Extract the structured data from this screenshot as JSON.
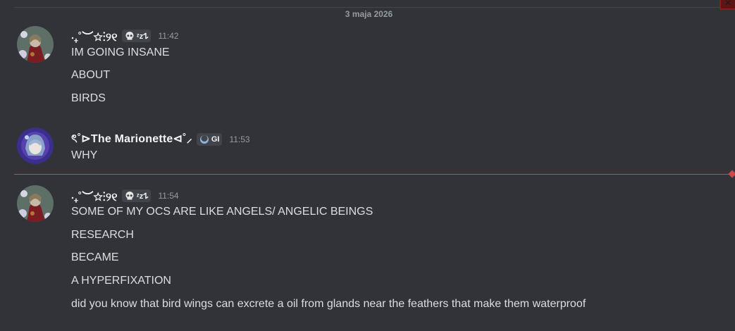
{
  "date_divider": "3 maja 2026",
  "messages": [
    {
      "username": "‧₊˚︶☆⋮୨୧",
      "badge": "ᶻz𐰁",
      "time": "11:42",
      "lines": [
        "IM GOING INSANE",
        "ABOUT",
        "BIRDS"
      ]
    },
    {
      "username": "ৎ˚⊳The Marionette⊲˚⸝",
      "badge": "GI",
      "time": "11:53",
      "lines": [
        "WHY"
      ]
    },
    {
      "username": "‧₊˚︶☆⋮୨୧",
      "badge": "ᶻz𐰁",
      "time": "11:54",
      "lines": [
        "SOME OF MY OCS ARE LIKE ANGELS/ ANGELIC BEINGS",
        "RESEARCH",
        "BECAME",
        "A HYPERFIXATION",
        "did you know that bird wings can excrete a oil from glands near the feathers that make them waterproof"
      ]
    }
  ],
  "colors": {
    "background": "#323339",
    "new_messages_line": "#d0464b",
    "username": "#f2f3f5",
    "timestamp": "#949ba4"
  },
  "icons": {
    "badge_1": "skull-icon",
    "badge_2": "crescent-moon-icon"
  }
}
